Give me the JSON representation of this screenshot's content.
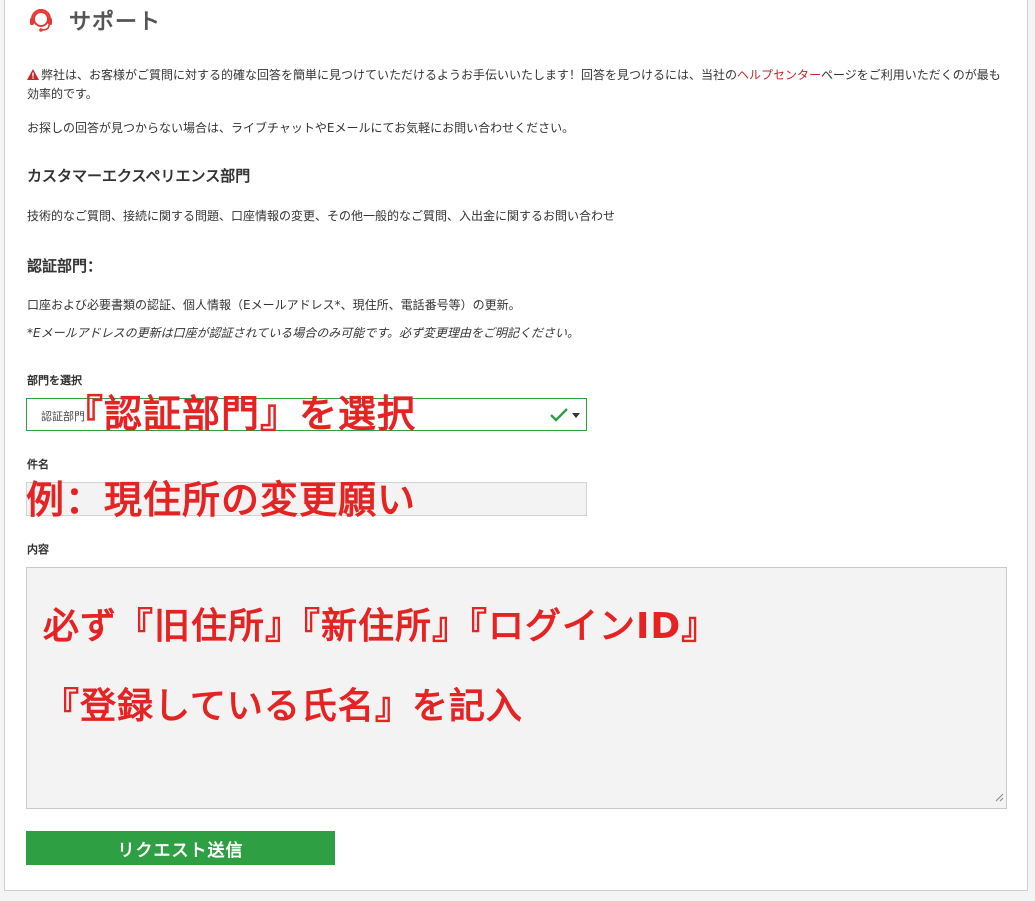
{
  "header": {
    "title": "サポート",
    "icon": "support-headset-icon",
    "accent": "#e53935"
  },
  "notice": {
    "icon": "warning-icon",
    "text_before": "弊社は、お客様がご質問に対する的確な回答を簡単に見つけていただけるようお手伝いいたします！回答を見つけるには、当社の",
    "link_label": "ヘルプセンター",
    "text_after": "ページをご利用いただくのが最も効率的です。",
    "contact_text": "お探しの回答が見つからない場合は、ライブチャットやEメールにてお気軽にお問い合わせください。"
  },
  "cx_department": {
    "title": "カスタマーエクスペリエンス部門",
    "description": "技術的なご質問、接続に関する問題、口座情報の変更、その他一般的なご質問、入出金に関するお問い合わせ"
  },
  "verification_department": {
    "title": "認証部門：",
    "description": "口座および必要書類の認証、個人情報（Eメールアドレス*、現住所、電話番号等）の更新。",
    "note": "*Eメールアドレスの更新は口座が認証されている場合のみ可能です。必ず変更理由をご明記ください。"
  },
  "form": {
    "department_label": "部門を選択",
    "department_value": "認証部門",
    "subject_label": "件名",
    "subject_value": "",
    "content_label": "内容",
    "content_value": "",
    "submit_label": "リクエスト送信"
  },
  "annotations": {
    "select_hint": "『認証部門』を選択",
    "subject_hint": "例：現住所の変更願い",
    "content_hint_line1": "必ず『旧住所』『新住所』『ログインID』",
    "content_hint_line2": "『登録している氏名』を記入"
  },
  "colors": {
    "primary_green": "#2ea043",
    "annotation_red": "#e52323",
    "link_red": "#c62828"
  }
}
